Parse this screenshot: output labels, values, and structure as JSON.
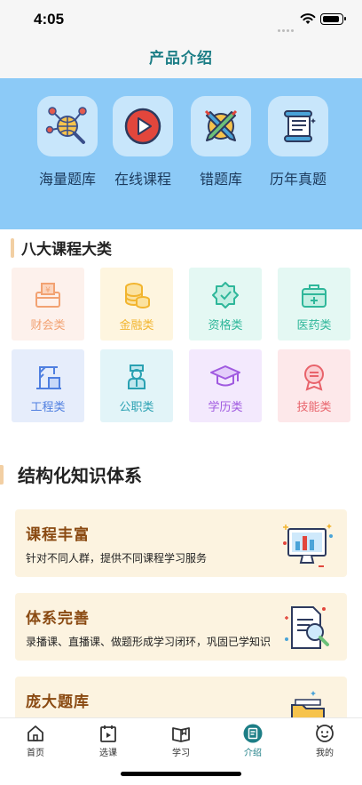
{
  "status_bar": {
    "time": "4:05"
  },
  "nav": {
    "title": "产品介绍"
  },
  "quick_links": [
    {
      "label": "海量题库",
      "icon": "globe-magnifier-icon"
    },
    {
      "label": "在线课程",
      "icon": "play-icon"
    },
    {
      "label": "错题库",
      "icon": "crossed-pencils-icon"
    },
    {
      "label": "历年真题",
      "icon": "scroll-icon"
    }
  ],
  "categories_section": {
    "title": "八大课程大类",
    "items": [
      {
        "label": "财会类",
        "icon": "money-box-icon",
        "color": "#f2a272",
        "bg": "#fdf1ec"
      },
      {
        "label": "金融类",
        "icon": "coins-icon",
        "color": "#f2b52f",
        "bg": "#fef5df"
      },
      {
        "label": "资格类",
        "icon": "badge-icon",
        "color": "#2fb79a",
        "bg": "#e4f8f3"
      },
      {
        "label": "医药类",
        "icon": "medical-kit-icon",
        "color": "#2fb79a",
        "bg": "#e4f8f3"
      },
      {
        "label": "工程类",
        "icon": "crane-icon",
        "color": "#4f7fe0",
        "bg": "#e6edfb"
      },
      {
        "label": "公职类",
        "icon": "officer-icon",
        "color": "#2aa1b2",
        "bg": "#e2f4f8"
      },
      {
        "label": "学历类",
        "icon": "graduation-cap-icon",
        "color": "#a05ae0",
        "bg": "#f3e9fd"
      },
      {
        "label": "技能类",
        "icon": "skill-badge-icon",
        "color": "#e8636b",
        "bg": "#fde8ea"
      }
    ]
  },
  "knowledge_section": {
    "title": "结构化知识体系",
    "features": [
      {
        "title": "课程丰富",
        "desc": "针对不同人群，提供不同课程学习服务",
        "icon": "monitor-chart-icon"
      },
      {
        "title": "体系完善",
        "desc": "录播课、直播课、做题形成学习闭环，巩固已学知识",
        "icon": "document-magnifier-icon"
      },
      {
        "title": "庞大题库",
        "desc": "",
        "icon": "folder-icon"
      }
    ]
  },
  "tab_bar": {
    "active": "介绍",
    "active_color": "#1d7e86",
    "items": [
      {
        "label": "首页",
        "icon": "home-icon"
      },
      {
        "label": "选课",
        "icon": "course-select-icon"
      },
      {
        "label": "学习",
        "icon": "book-icon"
      },
      {
        "label": "介绍",
        "icon": "intro-icon"
      },
      {
        "label": "我的",
        "icon": "profile-icon"
      }
    ]
  }
}
